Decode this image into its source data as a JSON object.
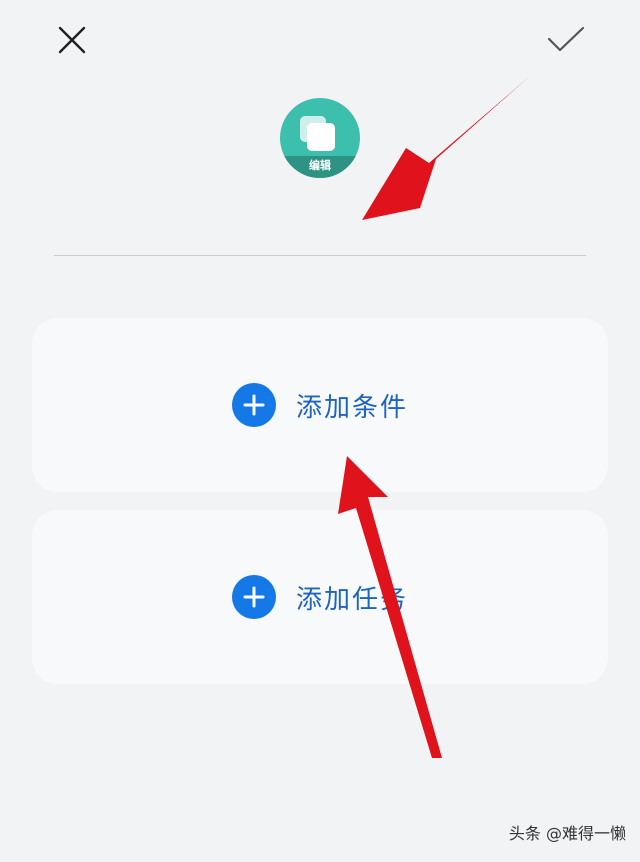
{
  "header": {
    "close_icon": "close-icon",
    "confirm_icon": "checkmark-icon"
  },
  "app_icon": {
    "badge_label": "编辑"
  },
  "cards": {
    "condition_label": "添加条件",
    "task_label": "添加任务"
  },
  "watermark": "头条 @难得一懒",
  "colors": {
    "background": "#f1f3f5",
    "card": "#f8f9fb",
    "accent": "#1478e6",
    "label": "#1b64c2",
    "icon_teal": "#3dbfad",
    "annotation_arrow": "#e0121b"
  }
}
